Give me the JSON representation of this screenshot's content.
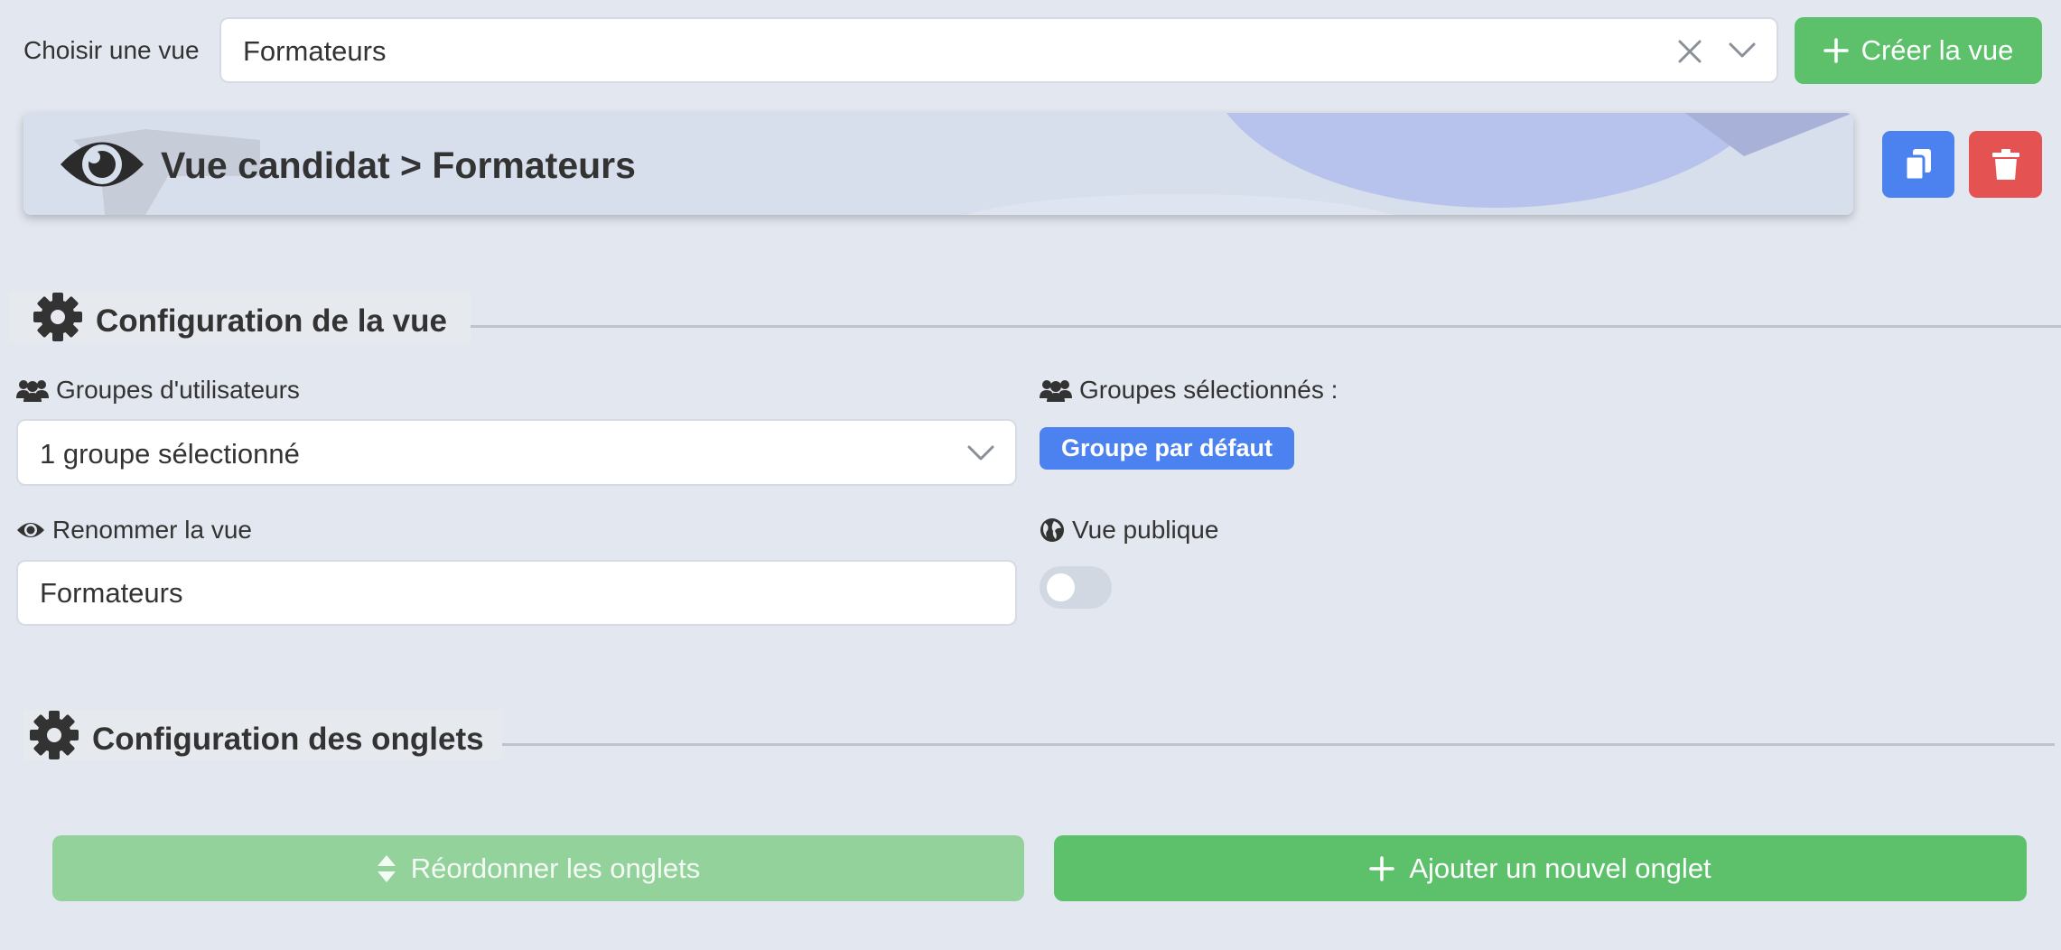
{
  "toolbar": {
    "choose_label": "Choisir une vue",
    "selected_view": "Formateurs",
    "create_label": "Créer la vue"
  },
  "banner": {
    "title": "Vue candidat > Formateurs"
  },
  "view_config": {
    "title": "Configuration de la vue",
    "user_groups_label": "Groupes d'utilisateurs",
    "user_groups_value": "1 groupe sélectionné",
    "selected_groups_label": "Groupes sélectionnés :",
    "selected_groups": [
      "Groupe par défaut"
    ],
    "rename_label": "Renommer la vue",
    "rename_value": "Formateurs",
    "public_label": "Vue publique",
    "public_enabled": false
  },
  "tabs_config": {
    "title": "Configuration des onglets",
    "reorder_label": "Réordonner les onglets",
    "add_label": "Ajouter un nouvel onglet"
  },
  "colors": {
    "background": "#e3e7ef",
    "success": "#5cc16a",
    "success_disabled": "#94d29c",
    "primary": "#4c82ef",
    "danger": "#e55252",
    "banner": "#d8dfec",
    "toggle_off": "#d2d8e2"
  },
  "icons": {
    "clear": "close-icon",
    "dropdown": "chevron-down-icon",
    "create": "plus-icon",
    "banner": "eye-icon",
    "copy": "copy-icon",
    "delete": "trash-icon",
    "section": "gear-icon",
    "groups": "users-icon",
    "rename": "eye-icon",
    "public": "globe-icon",
    "reorder": "sort-icon",
    "add": "plus-icon"
  }
}
